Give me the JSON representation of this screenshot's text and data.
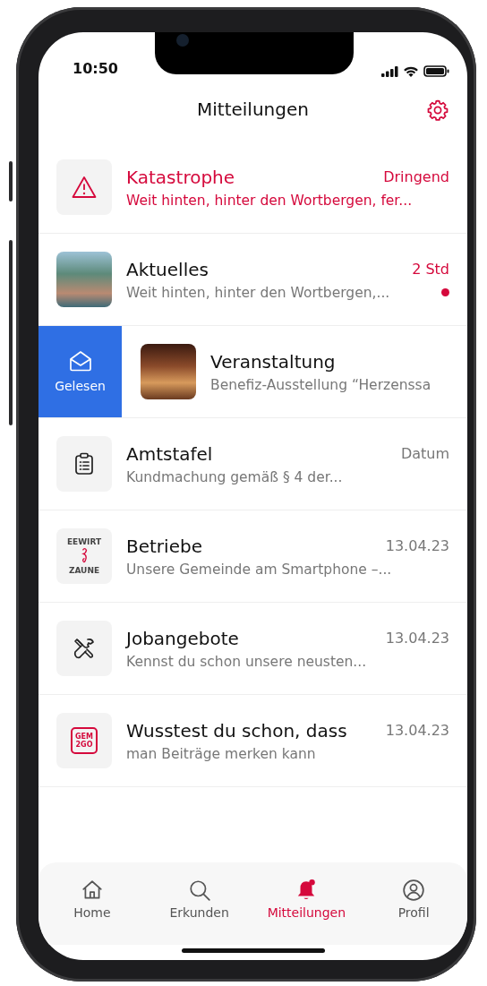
{
  "status_bar": {
    "time": "10:50"
  },
  "header": {
    "title": "Mitteilungen"
  },
  "notifications": [
    {
      "kind": "plain",
      "urgent": true,
      "unread": false,
      "title": "Katastrophe",
      "meta": "Dringend",
      "preview": "Weit hinten, hinter den Wortbergen, fer..."
    },
    {
      "kind": "plain",
      "urgent": false,
      "unread": true,
      "title": "Aktuelles",
      "meta": "2 Std",
      "preview": "Weit hinten, hinter den Wortbergen,..."
    },
    {
      "kind": "swiped",
      "urgent": false,
      "unread": false,
      "title": "Veranstaltung",
      "preview": "Benefiz-Ausstellung “Herzenssa",
      "action": "Gelesen"
    },
    {
      "kind": "plain",
      "urgent": false,
      "unread": false,
      "title": "Amtstafel",
      "meta": "Datum",
      "preview": "Kundmachung gemäß § 4 der..."
    },
    {
      "kind": "plain",
      "logo_text": [
        "EEWIRT",
        "ZAUNE"
      ],
      "urgent": false,
      "unread": false,
      "title": "Betriebe",
      "meta": "13.04.23",
      "preview": "Unsere Gemeinde am Smartphone –..."
    },
    {
      "kind": "plain",
      "urgent": false,
      "unread": false,
      "title": "Jobangebote",
      "meta": "13.04.23",
      "preview": "Kennst du schon unsere neusten..."
    },
    {
      "kind": "plain",
      "logo_text": [
        "GEM",
        "2GO"
      ],
      "urgent": false,
      "unread": false,
      "title": "Wusstest du schon, dass",
      "meta": "13.04.23",
      "preview": "man Beiträge merken kann"
    }
  ],
  "tab_bar": [
    {
      "label": "Home",
      "selected": false
    },
    {
      "label": "Erkunden",
      "selected": false
    },
    {
      "label": "Mitteilungen",
      "selected": true
    },
    {
      "label": "Profil",
      "selected": false
    }
  ]
}
